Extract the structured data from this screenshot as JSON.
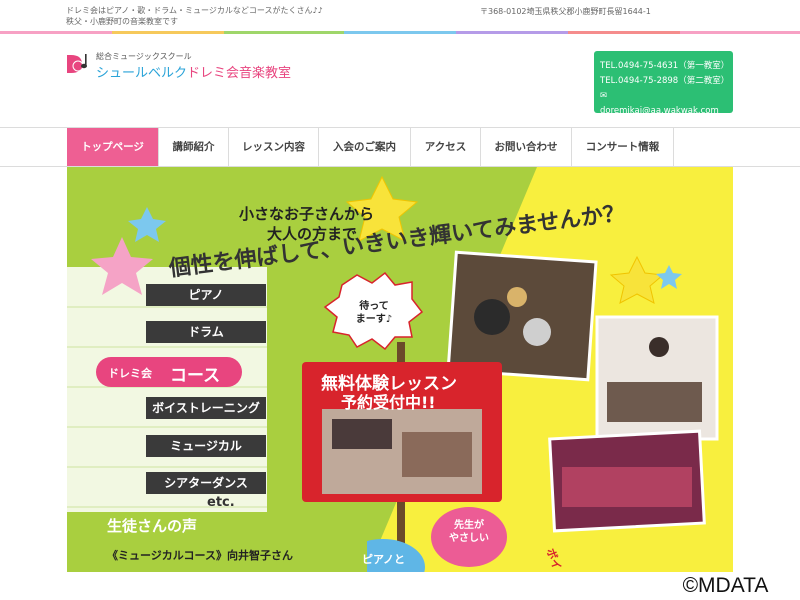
{
  "topbar": {
    "tagline_line1": "ドレミ会はピアノ・歌・ドラム・ミュージカルなどコースがたくさん♪♪",
    "tagline_line2": "秩父・小鹿野町の音楽教室です",
    "address": "〒368-0102埼玉県秩父郡小鹿野町長留1644-1"
  },
  "logo": {
    "subtitle": "総合ミュージックスクール",
    "name_part1": "シュールベルク",
    "name_part2": "ドレミ会音楽教室"
  },
  "contact": {
    "tel1": "TEL.0494-75-4631（第一教室）",
    "tel2": "TEL.0494-75-2898（第二教室）",
    "email": "doremikai@aa.wakwak.com"
  },
  "nav": {
    "items": [
      {
        "label": "トップページ"
      },
      {
        "label": "講師紹介"
      },
      {
        "label": "レッスン内容"
      },
      {
        "label": "入会のご案内"
      },
      {
        "label": "アクセス"
      },
      {
        "label": "お問い合わせ"
      },
      {
        "label": "コンサート情報"
      }
    ]
  },
  "hero": {
    "headline1": "小さなお子さんから",
    "headline2": "大人の方まで",
    "headline3": "個性を伸ばして、いきいき輝いてみませんか？",
    "courses": [
      "ピアノ",
      "ドラム",
      "ボイストレーニング",
      "ミュージカル",
      "シアターダンス"
    ],
    "course_badge_small": "ドレミ会",
    "course_badge_big": "コース",
    "etc": "etc.",
    "waiting": "待って\nまーす♪",
    "free_trial_line1": "無料体験レッスン",
    "free_trial_line2": "予約受付中!!",
    "voice_title": "生徒さんの声",
    "voice_line": "《ミュージカルコース》向井智子さん",
    "bubble_teacher": "先生が\nやさしい",
    "bubble_piano": "ピアノと",
    "side_fragment": "ボイ"
  },
  "footer": {
    "copyright": "©MDATA"
  },
  "colors": {
    "accent_pink": "#ee5f93",
    "contact_green": "#2cbf74",
    "logo_blue": "#2aa3d8",
    "hero_green": "#a9cf3f",
    "hero_yellow": "#f8ef3e",
    "trial_red": "#d8242c"
  }
}
